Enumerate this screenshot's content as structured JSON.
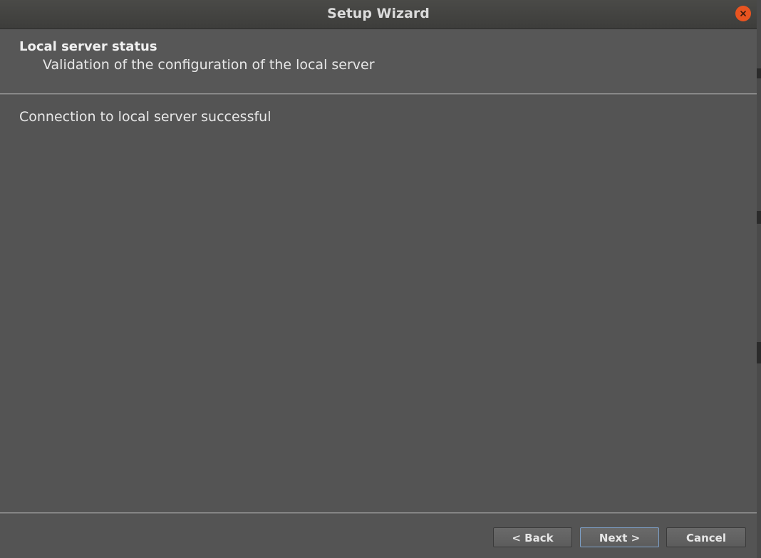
{
  "window": {
    "title": "Setup Wizard"
  },
  "header": {
    "title": "Local server status",
    "subtitle": "Validation of the configuration of the local server"
  },
  "content": {
    "status_message": "Connection to local server successful"
  },
  "buttons": {
    "back_label": "< Back",
    "next_label": "Next >",
    "cancel_label": "Cancel"
  },
  "icons": {
    "close": "close-icon"
  },
  "colors": {
    "close_accent": "#e95420",
    "default_button_border": "#7da0c8"
  }
}
